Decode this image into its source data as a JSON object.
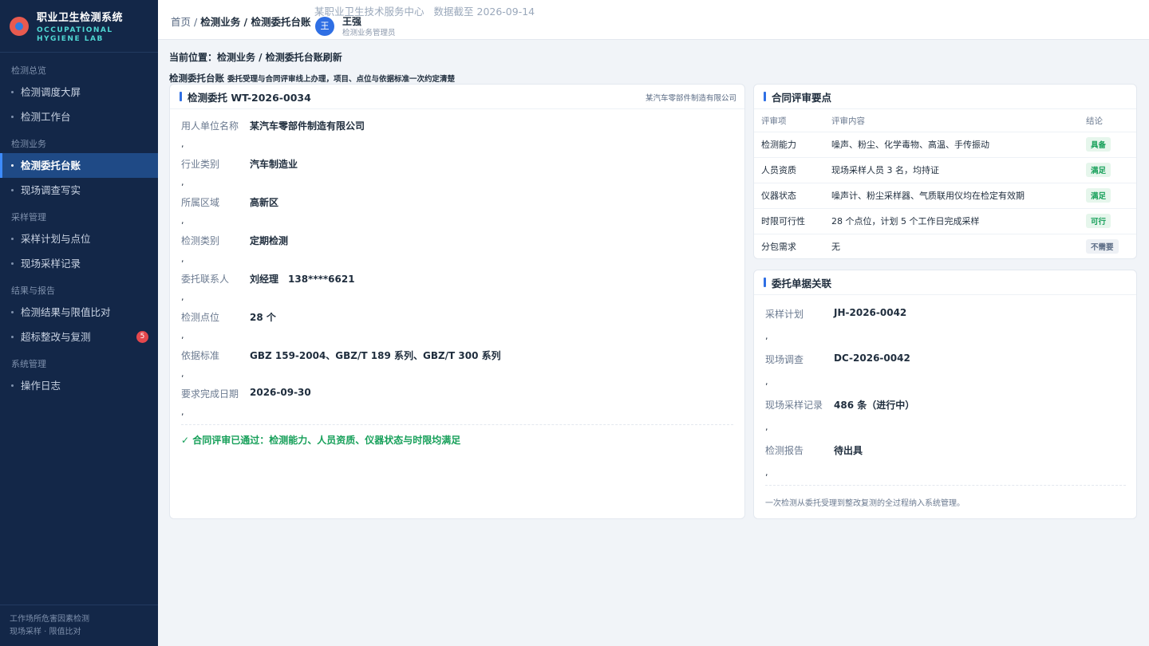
{
  "brand": {
    "title": "职业卫生检测系统",
    "sub1": "OCCUPATIONAL",
    "sub2": "HYGIENE LAB"
  },
  "sidebar": {
    "groups": [
      {
        "label": "检测总览",
        "items": [
          "检测调度大屏",
          "检测工作台"
        ]
      },
      {
        "label": "检测业务",
        "items": [
          "检测委托台账",
          "现场调查写实"
        ]
      },
      {
        "label": "采样管理",
        "items": [
          "采样计划与点位",
          "现场采样记录"
        ]
      },
      {
        "label": "结果与报告",
        "items": [
          "检测结果与限值比对",
          "超标整改与复测"
        ]
      },
      {
        "label": "系统管理",
        "items": [
          "操作日志"
        ]
      }
    ],
    "active_item": "检测委托台账",
    "badge_count": "5",
    "footer_line1": "工作场所危害因素检测",
    "footer_line2": "现场采样 · 限值比对"
  },
  "header": {
    "crumb_home": "首页",
    "crumb_sep": "/",
    "crumb_rest": "检测业务 / 检测委托台账",
    "org": "某职业卫生技术服务中心",
    "data_date": "数据截至 2026-09-14",
    "user_initial": "王",
    "user_name": "王强",
    "user_role": "检测业务管理员"
  },
  "main": {
    "location": "当前位置：检测业务 / 检测委托台账刷新",
    "subtitle": "检测委托台账",
    "subtitle_desc": "委托受理与合同评审线上办理，项目、点位与依据标准一次约定清楚"
  },
  "entrust": {
    "title": "检测委托 WT-2026-0034",
    "company_tag": "某汽车零部件制造有限公司",
    "separator": ",",
    "fields": [
      {
        "k": "用人单位名称",
        "v": "某汽车零部件制造有限公司"
      },
      {
        "k": "行业类别",
        "v": "汽车制造业"
      },
      {
        "k": "所属区域",
        "v": "高新区"
      },
      {
        "k": "检测类别",
        "v": "定期检测"
      },
      {
        "k": "委托联系人",
        "v": "刘经理　138****6621"
      },
      {
        "k": "检测点位",
        "v": "28 个"
      },
      {
        "k": "依据标准",
        "v": "GBZ 159-2004、GBZ/T 189 系列、GBZ/T 300 系列"
      },
      {
        "k": "要求完成日期",
        "v": "2026-09-30"
      }
    ],
    "pass_text": "✓ 合同评审已通过：检测能力、人员资质、仪器状态与时限均满足"
  },
  "review": {
    "title": "合同评审要点",
    "headers": [
      "评审项",
      "评审内容",
      "结论"
    ],
    "rows": [
      {
        "item": "检测能力",
        "content": "噪声、粉尘、化学毒物、高温、手传振动",
        "result": "具备",
        "tone": "green"
      },
      {
        "item": "人员资质",
        "content": "现场采样人员 3 名，均持证",
        "result": "满足",
        "tone": "green"
      },
      {
        "item": "仪器状态",
        "content": "噪声计、粉尘采样器、气质联用仪均在检定有效期",
        "result": "满足",
        "tone": "green"
      },
      {
        "item": "时限可行性",
        "content": "28 个点位，计划 5 个工作日完成采样",
        "result": "可行",
        "tone": "green"
      },
      {
        "item": "分包需求",
        "content": "无",
        "result": "不需要",
        "tone": "gray"
      }
    ]
  },
  "links": {
    "title": "委托单据关联",
    "separator": ",",
    "rows": [
      {
        "k": "采样计划",
        "v": "JH-2026-0042"
      },
      {
        "k": "现场调查",
        "v": "DC-2026-0042"
      },
      {
        "k": "现场采样记录",
        "v": "486 条（进行中）"
      },
      {
        "k": "检测报告",
        "v": "待出具"
      }
    ],
    "note": "一次检测从委托受理到整改复测的全过程纳入系统管理。"
  },
  "colors": {
    "sidebar_bg": "#132748",
    "accent": "#2f6fe4",
    "success": "#17a05a",
    "danger": "#e5484d"
  }
}
